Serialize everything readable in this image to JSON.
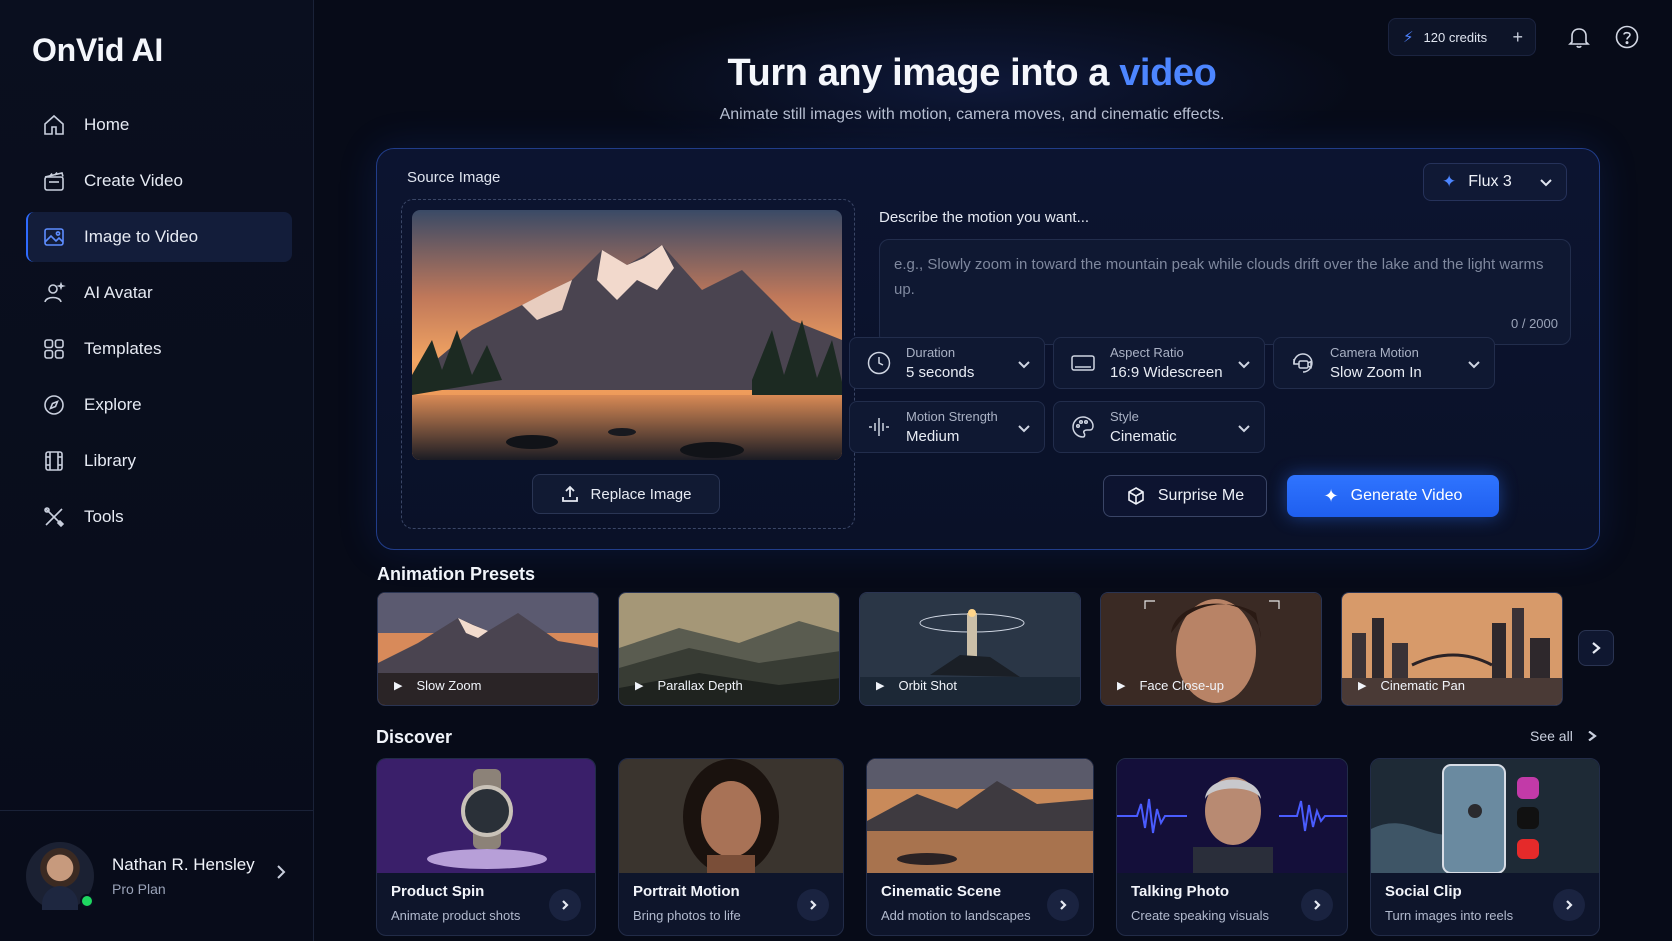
{
  "app": {
    "name": "OnVid AI"
  },
  "sidebar": {
    "items": [
      {
        "label": "Home",
        "icon": "home-icon"
      },
      {
        "label": "Create Video",
        "icon": "clapperboard-icon"
      },
      {
        "label": "Image to Video",
        "icon": "image-icon",
        "active": true
      },
      {
        "label": "AI Avatar",
        "icon": "avatar-icon"
      },
      {
        "label": "Templates",
        "icon": "templates-icon"
      },
      {
        "label": "Explore",
        "icon": "compass-icon"
      },
      {
        "label": "Library",
        "icon": "film-icon"
      },
      {
        "label": "Tools",
        "icon": "tools-icon"
      }
    ]
  },
  "user": {
    "name": "Nathan R. Hensley",
    "plan": "Pro Plan",
    "status_color": "#1ed760"
  },
  "topbar": {
    "credits": "120 credits"
  },
  "hero": {
    "title_prefix": "Turn any image into a ",
    "title_accent": "video",
    "subtitle": "Animate still images with motion, camera moves, and cinematic effects."
  },
  "panel": {
    "source_label": "Source Image",
    "replace_label": "Replace Image",
    "model": "Flux 3",
    "prompt_label": "Describe the motion you want...",
    "prompt_placeholder": "e.g., Slowly zoom in toward the mountain peak while clouds drift over the lake and the light warms up.",
    "prompt_count": "0 / 2000",
    "options": [
      {
        "label": "Duration",
        "value": "5 seconds",
        "icon": "clock-icon"
      },
      {
        "label": "Aspect Ratio",
        "value": "16:9 Widescreen",
        "icon": "aspect-ratio-icon"
      },
      {
        "label": "Camera Motion",
        "value": "Slow Zoom In",
        "icon": "camera-motion-icon"
      },
      {
        "label": "Motion Strength",
        "value": "Medium",
        "icon": "waveform-icon"
      },
      {
        "label": "Style",
        "value": "Cinematic",
        "icon": "palette-icon"
      }
    ],
    "surprise_label": "Surprise Me",
    "generate_label": "Generate Video"
  },
  "presets": {
    "title": "Animation Presets",
    "items": [
      {
        "label": "Slow Zoom"
      },
      {
        "label": "Parallax Depth"
      },
      {
        "label": "Orbit Shot"
      },
      {
        "label": "Face Close-up"
      },
      {
        "label": "Cinematic Pan"
      }
    ]
  },
  "discover": {
    "title": "Discover",
    "see_all": "See all",
    "items": [
      {
        "title": "Product Spin",
        "subtitle": "Animate product shots"
      },
      {
        "title": "Portrait Motion",
        "subtitle": "Bring photos to life"
      },
      {
        "title": "Cinematic Scene",
        "subtitle": "Add motion to landscapes"
      },
      {
        "title": "Talking Photo",
        "subtitle": "Create speaking visuals"
      },
      {
        "title": "Social Clip",
        "subtitle": "Turn images into reels"
      }
    ]
  },
  "colors": {
    "accent": "#2f74ff",
    "background": "#070b18",
    "panel_border": "#213d8a"
  }
}
